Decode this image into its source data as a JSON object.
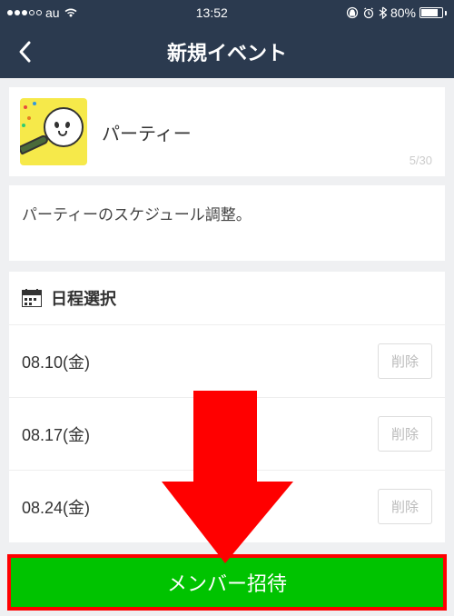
{
  "statusBar": {
    "carrier": "au",
    "time": "13:52",
    "battery": "80%"
  },
  "nav": {
    "title": "新規イベント"
  },
  "event": {
    "title": "パーティー",
    "counter": "5/30",
    "description": "パーティーのスケジュール調整。"
  },
  "datesSection": {
    "title": "日程選択",
    "dates": [
      {
        "label": "08.10(金)",
        "delete": "削除"
      },
      {
        "label": "08.17(金)",
        "delete": "削除"
      },
      {
        "label": "08.24(金)",
        "delete": "削除"
      }
    ]
  },
  "inviteButton": "メンバー招待"
}
